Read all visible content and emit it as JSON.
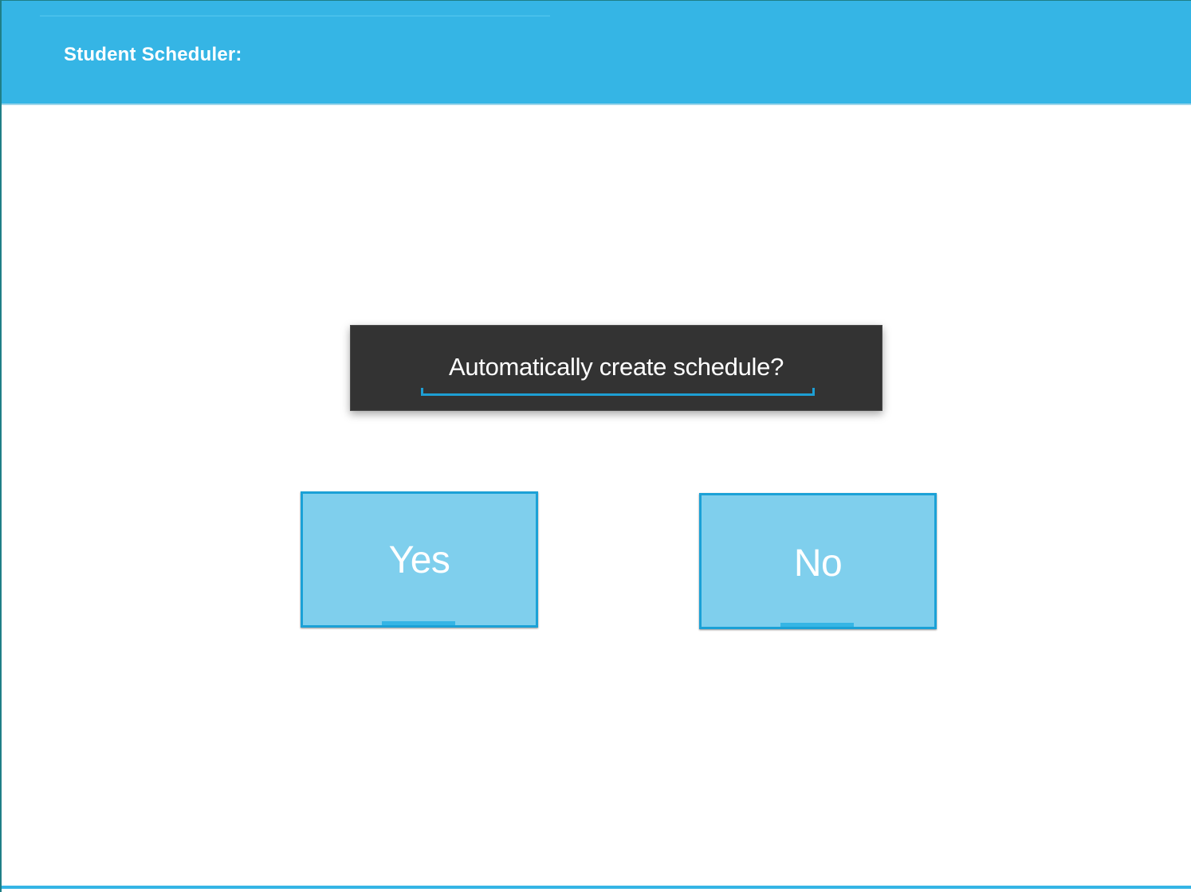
{
  "header": {
    "title": "Student Scheduler:"
  },
  "dialog": {
    "prompt": "Automatically create schedule?",
    "yes_label": "Yes",
    "no_label": "No"
  },
  "colors": {
    "accent": "#35b5e5",
    "button_fill": "#7fcfed",
    "button_border": "#1ba1d6",
    "prompt_background": "#333333"
  }
}
